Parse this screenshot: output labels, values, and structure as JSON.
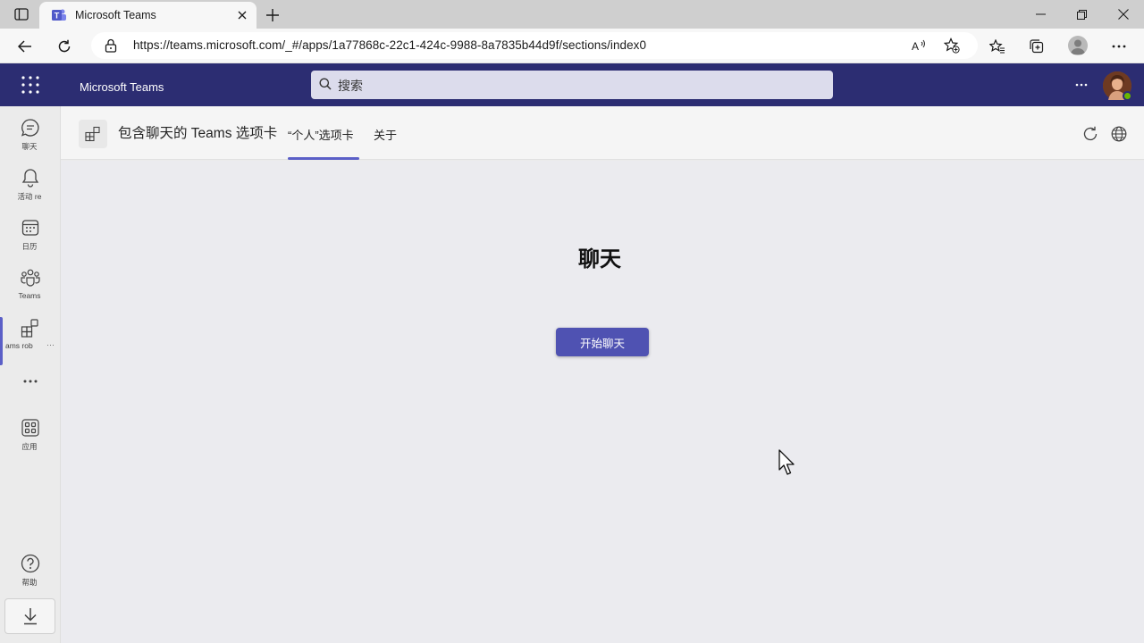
{
  "browser": {
    "tab_title": "Microsoft Teams",
    "url": "https://teams.microsoft.com/_#/apps/1a77868c-22c1-424c-9988-8a7835b44d9f/sections/index0"
  },
  "teams": {
    "app_name": "Microsoft Teams",
    "search_placeholder": "搜索"
  },
  "rail": {
    "items": [
      {
        "label": "聊天",
        "icon": "chat-icon"
      },
      {
        "label": "活动 re",
        "icon": "bell-icon"
      },
      {
        "label": "日历",
        "icon": "calendar-icon"
      },
      {
        "label": "Teams",
        "icon": "teams-icon"
      },
      {
        "label": "ams rob",
        "icon": "apps-tab-icon",
        "trailing": "···"
      },
      {
        "label": "应用",
        "icon": "apps-grid-icon"
      },
      {
        "label": "帮助",
        "icon": "help-icon"
      }
    ]
  },
  "appbar": {
    "title": "包含聊天的 Teams 选项卡",
    "tabs": [
      {
        "label": "“个人”选项卡",
        "active": true
      },
      {
        "label": "关于",
        "active": false
      }
    ]
  },
  "content": {
    "heading": "聊天",
    "button_label": "开始聊天"
  },
  "colors": {
    "teams_header": "#2c2d72",
    "accent": "#5b5fc7",
    "button": "#4f52b2"
  }
}
